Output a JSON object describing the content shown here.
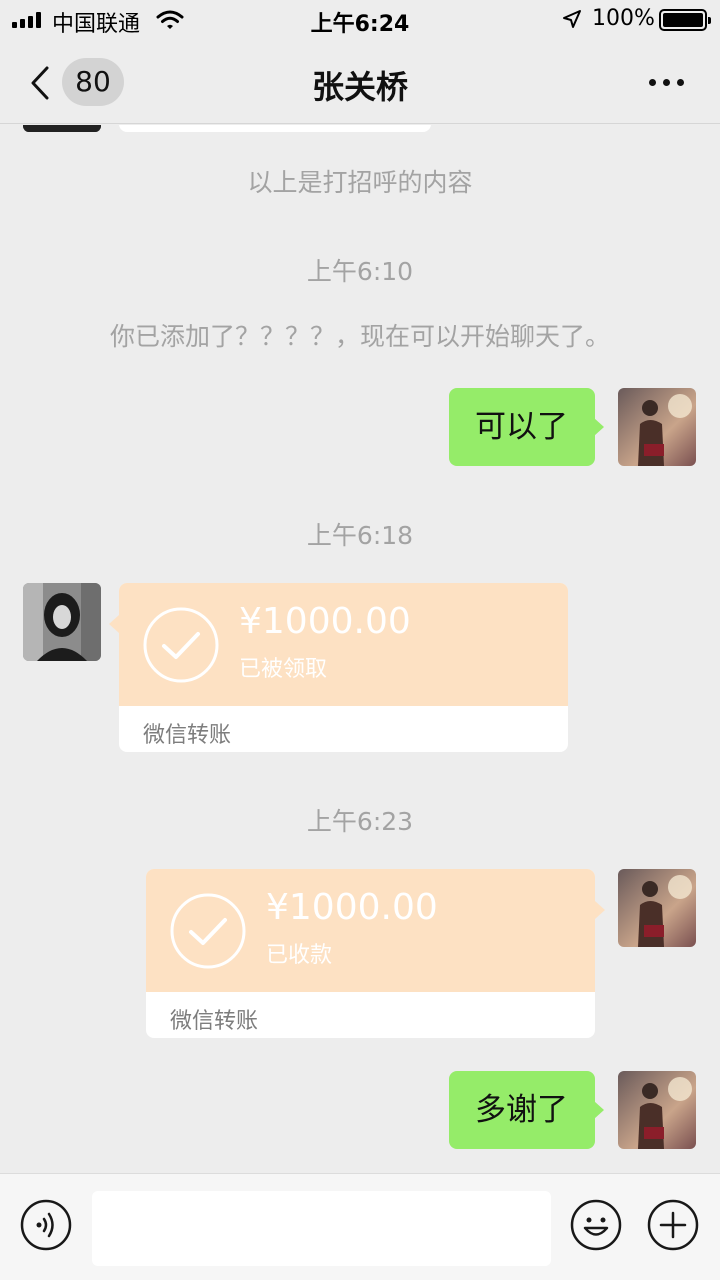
{
  "status_bar": {
    "carrier": "中国联通",
    "time": "上午6:24",
    "battery": "100%"
  },
  "nav": {
    "back_count": "80",
    "title": "张关桥"
  },
  "messages": {
    "greeting_note": "以上是打招呼的内容",
    "time_1": "上午6:10",
    "added_note": "你已添加了？？？？，现在可以开始聊天了。",
    "msg_1": "可以了",
    "time_2": "上午6:18",
    "transfer_1": {
      "amount": "¥1000.00",
      "status": "已被领取",
      "label": "微信转账"
    },
    "time_3": "上午6:23",
    "transfer_2": {
      "amount": "¥1000.00",
      "status": "已收款",
      "label": "微信转账"
    },
    "msg_2": "多谢了"
  },
  "input_bar": {
    "text_value": ""
  },
  "colors": {
    "background": "#ededed",
    "bubble_green": "#95ec69",
    "transfer_orange": "#fde1c3",
    "system_text": "#a3a3a3"
  },
  "icons": {
    "back": "chevron-left-icon",
    "more": "ellipsis-icon",
    "voice": "voice-icon",
    "emoji": "emoji-icon",
    "plus": "plus-icon",
    "transfer_check": "check-circle-icon"
  }
}
